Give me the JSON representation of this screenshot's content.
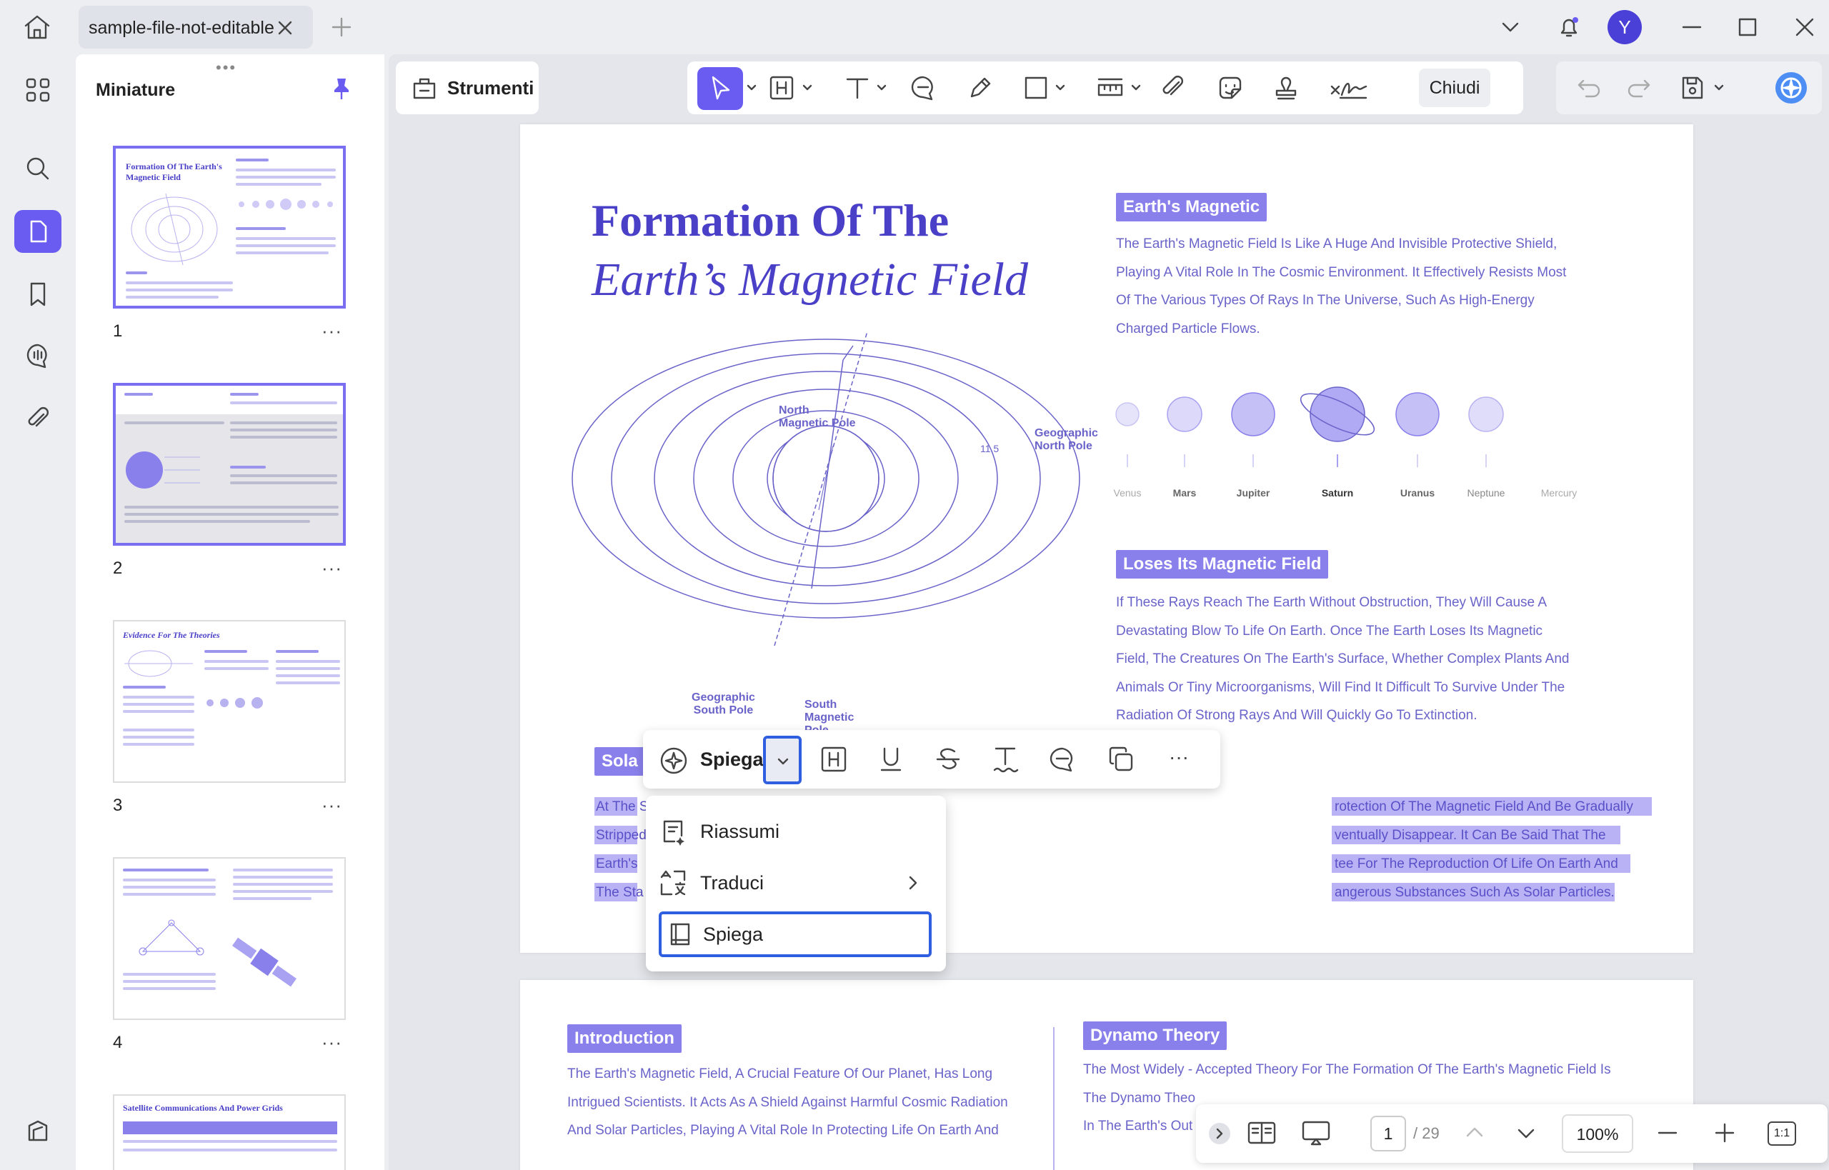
{
  "window": {
    "tab_title": "sample-file-not-editable",
    "avatar_letter": "Y"
  },
  "thumbnails": {
    "title": "Miniature",
    "pages": [
      {
        "num": "1",
        "title": "Formation Of The Earth's Magnetic Field"
      },
      {
        "num": "2",
        "title": ""
      },
      {
        "num": "3",
        "title": "Evidence For The Theories"
      },
      {
        "num": "4",
        "title": ""
      },
      {
        "num": "5",
        "title": "Satellite Communications And Power Grids"
      }
    ],
    "more": "···"
  },
  "toolbar": {
    "tools_label": "Strumenti",
    "close_label": "Chiudi"
  },
  "page1": {
    "title_line1": "Formation Of The",
    "title_line2": "Earth’s Magnetic Field",
    "diagram": {
      "north_magnetic_pole": [
        "North",
        "Magnetic Pole"
      ],
      "geographic_north_pole": [
        "Geographic",
        "North Pole"
      ],
      "geographic_south_pole": [
        "Geographic",
        "South Pole"
      ],
      "south_magnetic_pole": [
        "South",
        "Magnetic",
        "Pole"
      ],
      "angle": "11.5"
    },
    "section1": {
      "label": "Earth's Magnetic",
      "lines": [
        "The Earth's Magnetic Field Is Like A Huge And Invisible Protective Shield,",
        "Playing A Vital Role In The Cosmic Environment. It Effectively Resists Most",
        "Of The Various Types Of Rays In The Universe, Such As High-Energy",
        "Charged Particle Flows."
      ]
    },
    "planets": [
      "Venus",
      "Mars",
      "Jupiter",
      "Saturn",
      "Uranus",
      "Neptune",
      "Mercury"
    ],
    "section2": {
      "label": "Loses Its Magnetic Field",
      "lines": [
        "If These Rays Reach The Earth Without Obstruction, They Will Cause A",
        "Devastating Blow To Life On Earth. Once The Earth Loses Its Magnetic",
        "Field, The Creatures On The Earth's Surface, Whether Complex Plants And",
        "Animals Or Tiny Microorganisms, Will Find It Difficult To Survive Under The",
        "Radiation Of Strong Rays And Will Quickly Go To Extinction."
      ]
    },
    "section3": {
      "label_fragment": "Sola",
      "left_fragments": [
        "At The S",
        "Stripped",
        "Earth's",
        "The Sta"
      ],
      "right_fragments": [
        "rotection Of The Magnetic Field And Be Gradually",
        "ventually Disappear. It Can Be Said That The",
        "tee For The Reproduction Of Life On Earth And",
        "angerous Substances Such As Solar Particles."
      ]
    }
  },
  "page2": {
    "intro": {
      "label": "Introduction",
      "lines": [
        "The Earth's Magnetic Field, A Crucial Feature Of Our Planet, Has Long",
        "Intrigued Scientists. It Acts As A Shield Against Harmful Cosmic Radiation",
        "And Solar Particles, Playing A Vital Role In Protecting Life On Earth And"
      ]
    },
    "dynamo": {
      "label": "Dynamo Theory",
      "lines": [
        "The Most Widely - Accepted Theory For The Formation Of The Earth's Magnetic Field Is",
        "The Dynamo Theo",
        "In The Earth's Out"
      ]
    }
  },
  "ai_toolbar": {
    "main_label": "Spiega",
    "more": "···"
  },
  "ai_menu": {
    "items": [
      {
        "label": "Riassumi"
      },
      {
        "label": "Traduci"
      },
      {
        "label": "Spiega"
      }
    ]
  },
  "bottom_nav": {
    "page_current": "1",
    "page_total": "/ 29",
    "zoom": "100%",
    "fit_label": "1:1"
  }
}
